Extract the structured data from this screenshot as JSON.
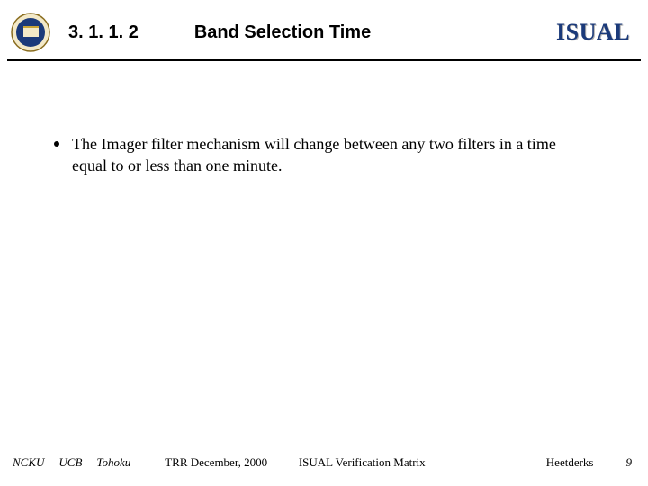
{
  "header": {
    "section_number": "3. 1. 1. 2",
    "title": "Band Selection Time",
    "brand": "ISUAL"
  },
  "content": {
    "bullet_text": "The Imager filter mechanism will change between any two filters in a time equal to or less than one minute."
  },
  "footer": {
    "org1": "NCKU",
    "org2": "UCB",
    "org3": "Tohoku",
    "trr": "TRR   December,  2000",
    "center": "ISUAL Verification Matrix",
    "author": "Heetderks",
    "page": "9"
  }
}
